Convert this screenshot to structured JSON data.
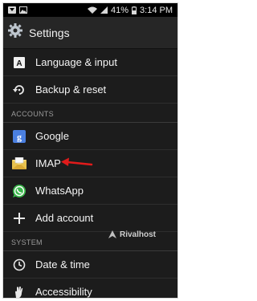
{
  "status_bar": {
    "battery_percent": "41%",
    "time": "3:14 PM",
    "icons": [
      "notification-icon",
      "image-icon",
      "wifi-icon",
      "signal-icon",
      "battery-icon"
    ]
  },
  "header": {
    "title": "Settings",
    "icon": "gear-icon"
  },
  "items": {
    "language": {
      "label": "Language & input",
      "icon": "keyboard-a-icon"
    },
    "backup": {
      "label": "Backup & reset",
      "icon": "restore-icon"
    },
    "google": {
      "label": "Google",
      "icon": "google-icon"
    },
    "imap": {
      "label": "IMAP",
      "icon": "envelope-icon"
    },
    "whatsapp": {
      "label": "WhatsApp",
      "icon": "whatsapp-icon"
    },
    "add_account": {
      "label": "Add account",
      "icon": "plus-icon"
    },
    "date_time": {
      "label": "Date & time",
      "icon": "clock-icon"
    },
    "accessibility": {
      "label": "Accessibility",
      "icon": "hand-icon"
    }
  },
  "sections": {
    "accounts": "ACCOUNTS",
    "system": "SYSTEM"
  },
  "watermark": {
    "brand": "Rivalhost"
  },
  "colors": {
    "background": "#1c1c1c",
    "google_blue": "#4a7fe0",
    "whatsapp_green": "#3ab54a",
    "arrow_red": "#e01b1b"
  }
}
